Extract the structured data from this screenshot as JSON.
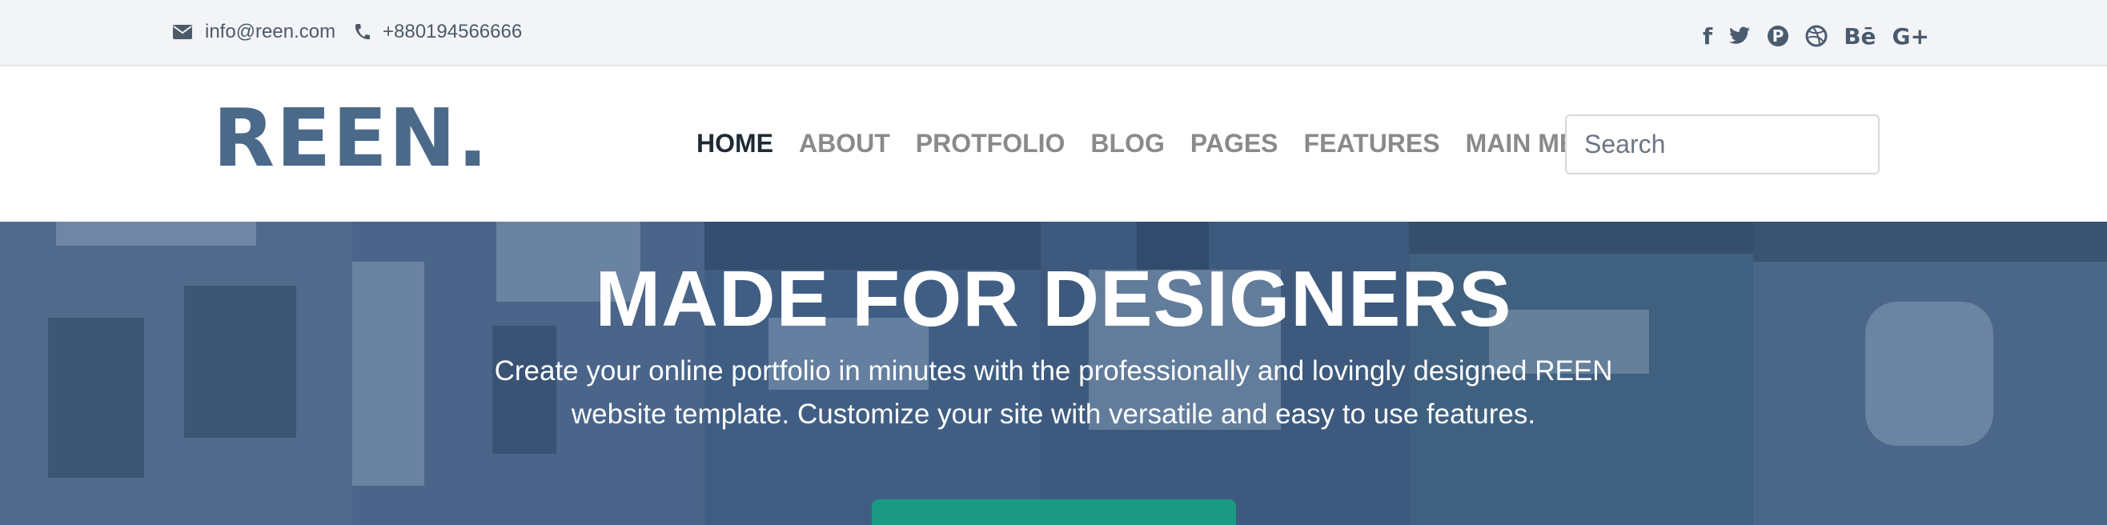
{
  "topbar": {
    "email": "info@reen.com",
    "phone": "+880194566666",
    "socials": [
      {
        "icon": "facebook-icon",
        "glyph": "f"
      },
      {
        "icon": "twitter-icon",
        "glyph": "🐦"
      },
      {
        "icon": "pinterest-icon",
        "glyph": "P"
      },
      {
        "icon": "dribbble-icon",
        "glyph": "◎"
      },
      {
        "icon": "behance-icon",
        "glyph": "Bē"
      },
      {
        "icon": "google-plus-icon",
        "glyph": "G+"
      }
    ]
  },
  "header": {
    "logo": "REEN.",
    "nav": [
      "HOME",
      "ABOUT",
      "PROTFOLIO",
      "BLOG",
      "PAGES",
      "FEATURES",
      "MAIN MENU"
    ],
    "search_placeholder": "Search"
  },
  "hero": {
    "title": "MADE FOR DESIGNERS",
    "subtitle": "Create your online portfolio in minutes with the professionally and lovingly designed REEN website template. Customize your site with versatile and easy to use features."
  },
  "colors": {
    "accent": "#1a9a82",
    "brand": "#4b6a8a",
    "hero_overlay": "#3f5c7e"
  }
}
